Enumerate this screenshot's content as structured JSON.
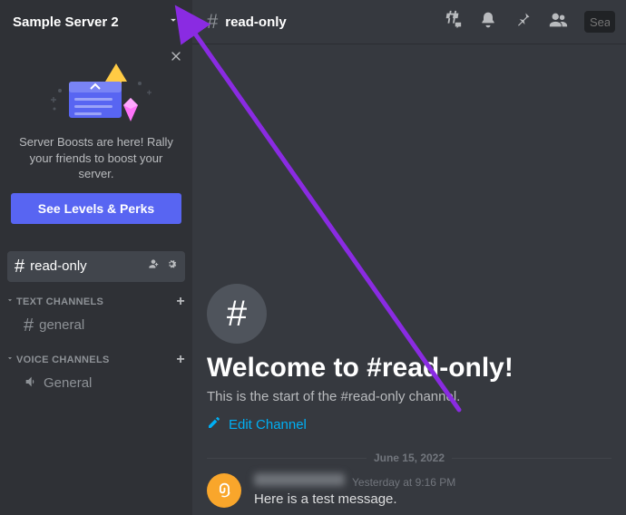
{
  "server": {
    "name": "Sample Server 2"
  },
  "boost": {
    "text": "Server Boosts are here! Rally your friends to boost your server.",
    "cta_label": "See Levels & Perks"
  },
  "sidebar": {
    "selected_channel": {
      "name": "read-only"
    },
    "categories": [
      {
        "name": "Text Channels",
        "channels": [
          {
            "name": "general",
            "type": "text"
          }
        ]
      },
      {
        "name": "Voice Channels",
        "channels": [
          {
            "name": "General",
            "type": "voice"
          }
        ]
      }
    ]
  },
  "channel_header": {
    "name": "read-only",
    "search_placeholder": "Search"
  },
  "welcome": {
    "title": "Welcome to #read-only!",
    "subtitle": "This is the start of the #read-only channel.",
    "edit_label": "Edit Channel"
  },
  "divider_date": "June 15, 2022",
  "message": {
    "timestamp": "Yesterday at 9:16 PM",
    "text": "Here is a test message."
  },
  "colors": {
    "blurple": "#5865f2",
    "link": "#00aff4",
    "bg_main": "#36393f",
    "bg_sidebar": "#2f3136",
    "annotation": "#8a2be2"
  }
}
